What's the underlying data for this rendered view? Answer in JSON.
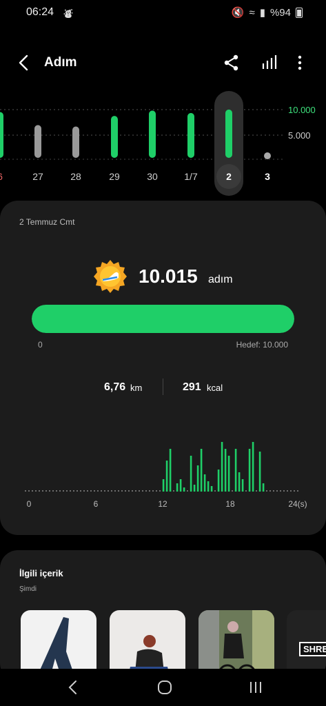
{
  "status_bar": {
    "time": "06:24",
    "battery": "%94"
  },
  "header": {
    "title": "Adım"
  },
  "week_chart": {
    "goal_high_label": "10.000",
    "goal_low_label": "5.000",
    "days": [
      {
        "label": "6",
        "steps": 9500,
        "met_goal": true,
        "style": "red"
      },
      {
        "label": "27",
        "steps": 6800,
        "met_goal": false,
        "style": "normal"
      },
      {
        "label": "28",
        "steps": 6500,
        "met_goal": false,
        "style": "normal"
      },
      {
        "label": "29",
        "steps": 8700,
        "met_goal": true,
        "style": "normal"
      },
      {
        "label": "30",
        "steps": 9800,
        "met_goal": true,
        "style": "normal"
      },
      {
        "label": "1/7",
        "steps": 9300,
        "met_goal": true,
        "style": "normal"
      },
      {
        "label": "2",
        "steps": 10015,
        "met_goal": true,
        "style": "selected"
      },
      {
        "label": "3",
        "steps": 0,
        "met_goal": false,
        "style": "bold"
      }
    ]
  },
  "summary": {
    "date": "2 Temmuz Cmt",
    "steps": "10.015",
    "steps_unit": "adım",
    "progress_fraction": 1.0,
    "progress_min": "0",
    "goal_label": "Hedef: 10.000",
    "distance": "6,76",
    "distance_unit": "km",
    "calories": "291",
    "calories_unit": "kcal"
  },
  "hourly_chart": {
    "x_labels": [
      "0",
      "6",
      "12",
      "18",
      "24(s)"
    ],
    "bars": [
      0,
      0,
      0,
      0,
      0,
      0,
      0,
      0,
      0,
      0,
      0,
      0,
      0,
      0,
      0,
      0,
      0,
      0,
      0,
      0,
      0,
      0,
      0,
      0,
      0,
      0,
      0,
      0,
      0,
      0,
      0,
      0,
      0,
      0,
      0,
      0,
      0,
      0,
      0,
      0,
      18,
      45,
      62,
      0,
      12,
      18,
      6,
      0,
      52,
      10,
      38,
      62,
      25,
      15,
      8,
      0,
      32,
      72,
      62,
      52,
      0,
      62,
      28,
      18,
      0,
      62,
      72,
      0,
      58,
      12,
      0,
      0,
      0,
      0,
      0,
      0,
      0,
      0,
      0,
      0
    ]
  },
  "related": {
    "title": "İlgili içerik",
    "subtitle": "Şimdi",
    "thumbnail_text": "SHRE"
  },
  "colors": {
    "accent": "#1fcf68",
    "gray_bar": "#9a9a9a",
    "card": "#1c1c1c"
  }
}
